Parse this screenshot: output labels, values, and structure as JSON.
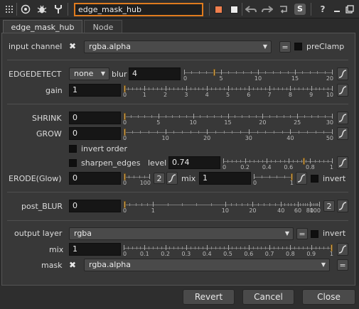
{
  "window": {
    "node_name": "edge_mask_hub"
  },
  "toolbar": {
    "s_label": "S",
    "help_label": "?"
  },
  "tabs": [
    {
      "label": "edge_mask_hub"
    },
    {
      "label": "Node"
    }
  ],
  "input_channel": {
    "label": "input channel",
    "value": "rgba.alpha",
    "equals": "=",
    "preclamp_label": "preClamp"
  },
  "edgedetect": {
    "label": "EDGEDETECT",
    "mode": "none",
    "blur_label": "blur",
    "blur_value": "4",
    "ticks": [
      "0",
      "5",
      "10",
      "15",
      "20"
    ],
    "blur_fraction": 0.2
  },
  "gain": {
    "label": "gain",
    "value": "1",
    "ticks": [
      "0",
      "1",
      "2",
      "3",
      "4",
      "5",
      "6",
      "7",
      "8",
      "9",
      "10"
    ],
    "fraction": 0.0
  },
  "shrink": {
    "label": "SHRINK",
    "value": "0",
    "ticks": [
      "0",
      "5",
      "10",
      "15",
      "20",
      "25",
      "30"
    ],
    "fraction": 0.0
  },
  "grow": {
    "label": "GROW",
    "value": "0",
    "ticks": [
      "0",
      "10",
      "20",
      "30",
      "40",
      "50"
    ],
    "fraction": 0.0
  },
  "invert_order": {
    "label": "invert order"
  },
  "sharpen": {
    "label": "sharpen_edges",
    "level_label": "level",
    "level_value": "0.74",
    "ticks": [
      "0",
      "0.2",
      "0.4",
      "0.6",
      "0.8",
      "1"
    ],
    "fraction": 0.74
  },
  "erode": {
    "label": "ERODE(Glow)",
    "value": "0",
    "ticks": [
      "0",
      "100"
    ],
    "fraction": 0.0,
    "count": "2",
    "mix_label": "mix",
    "mix_value": "1",
    "mix_ticks": [
      "0",
      "1"
    ],
    "mix_fraction": 1.0,
    "invert_label": "invert"
  },
  "post_blur": {
    "label": "post_BLUR",
    "value": "0",
    "ticks": [
      "0",
      "1",
      "10",
      "20",
      "40",
      "60",
      "80",
      "100"
    ],
    "count": "2"
  },
  "output": {
    "label": "output layer",
    "value": "rgba",
    "equals": "=",
    "invert_label": "invert"
  },
  "mix": {
    "label": "mix",
    "value": "1",
    "ticks": [
      "0",
      "0.1",
      "0.2",
      "0.3",
      "0.4",
      "0.5",
      "0.6",
      "0.7",
      "0.8",
      "0.9",
      "1"
    ],
    "fraction": 1.0
  },
  "mask": {
    "label": "mask",
    "value": "rgba.alpha",
    "equals": "="
  },
  "footer": {
    "revert": "Revert",
    "cancel": "Cancel",
    "close": "Close"
  }
}
